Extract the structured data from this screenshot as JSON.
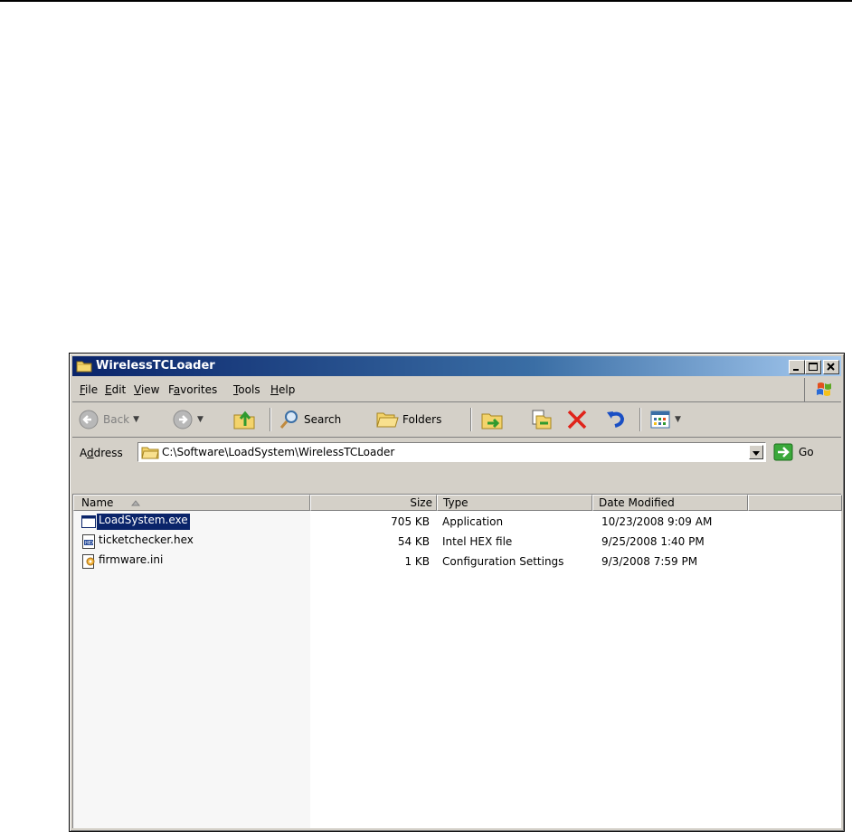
{
  "window": {
    "title": "WirelessTCLoader",
    "controls": [
      "minimize",
      "maximize",
      "close"
    ]
  },
  "menu": {
    "items": [
      {
        "label": "File",
        "accel": "F",
        "rest": "ile"
      },
      {
        "label": "Edit",
        "accel": "E",
        "rest": "dit"
      },
      {
        "label": "View",
        "accel": "V",
        "rest": "iew"
      },
      {
        "label": "Favorites",
        "pre": "F",
        "accel": "a",
        "rest": "vorites"
      },
      {
        "label": "Tools",
        "accel": "T",
        "rest": "ools"
      },
      {
        "label": "Help",
        "accel": "H",
        "rest": "elp"
      }
    ]
  },
  "toolbar": {
    "back_label": "Back",
    "search_label": "Search",
    "folders_label": "Folders"
  },
  "address": {
    "label": "Address",
    "label_pre": "A",
    "label_accel": "d",
    "label_rest": "dress",
    "path": "C:\\Software\\LoadSystem\\WirelessTCLoader",
    "go_label": "Go"
  },
  "columns": {
    "name": "Name",
    "size": "Size",
    "type": "Type",
    "date": "Date Modified"
  },
  "files": [
    {
      "name": "LoadSystem.exe",
      "size": "705 KB",
      "type": "Application",
      "date": "10/23/2008 9:09 AM",
      "icon": "application-icon",
      "selected": true
    },
    {
      "name": "ticketchecker.hex",
      "size": "54 KB",
      "type": "Intel HEX file",
      "date": "9/25/2008 1:40 PM",
      "icon": "hex-file-icon",
      "selected": false
    },
    {
      "name": "firmware.ini",
      "size": "1 KB",
      "type": "Configuration Settings",
      "date": "9/3/2008 7:59 PM",
      "icon": "config-file-icon",
      "selected": false
    }
  ],
  "colors": {
    "title_gradient_start": "#0a246a",
    "title_gradient_end": "#a6caf0",
    "selection": "#0a246a",
    "chrome": "#d4d0c8"
  }
}
